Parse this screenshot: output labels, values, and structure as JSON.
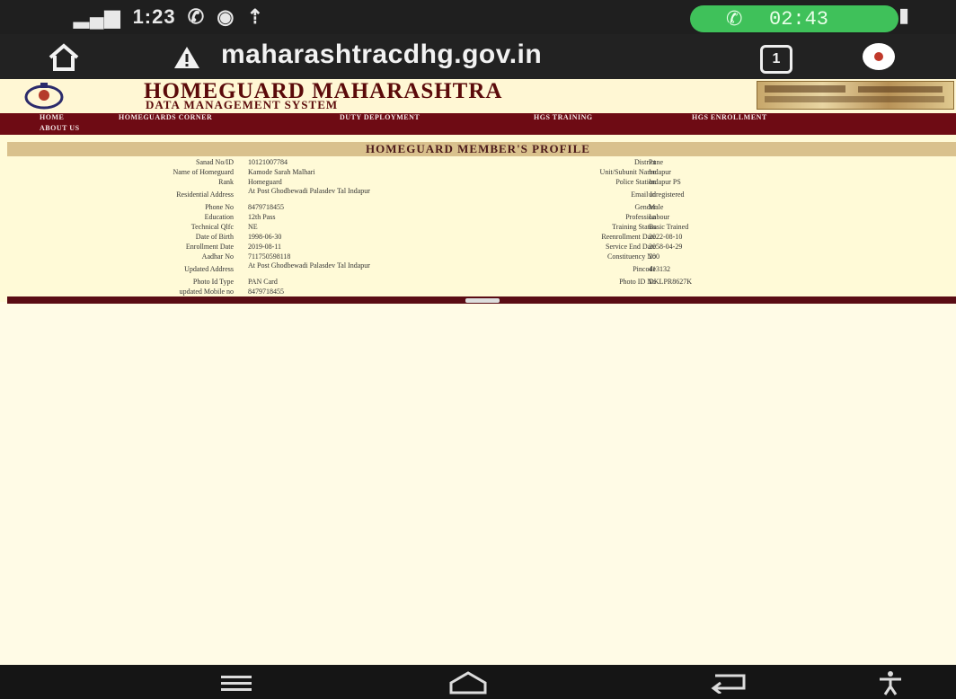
{
  "status_bar": {
    "time": "1:23",
    "call_timer": "02:43"
  },
  "browser": {
    "url": "maharashtracdhg.gov.in",
    "tab_count": "1"
  },
  "site": {
    "title": "HOMEGUARD MAHARASHTRA",
    "subtitle": "DATA MANAGEMENT SYSTEM",
    "nav": [
      "HOME",
      "HOMEGUARDS CORNER",
      "DUTY DEPLOYMENT",
      "HGS TRAINING",
      "HGS ENROLLMENT",
      "ABOUT US"
    ]
  },
  "profile": {
    "title": "HOMEGUARD MEMBER'S PROFILE",
    "left": [
      {
        "label": "Sanad No/ID",
        "value": "10121007784"
      },
      {
        "label": "Name of Homeguard",
        "value": "Kamode Sarah Malhari"
      },
      {
        "label": "Rank",
        "value": "Homeguard"
      },
      {
        "label": "Residential Address",
        "value": "At Post Ghodbewadi Palasdev Tal Indapur"
      },
      {
        "label": "Phone No",
        "value": "8479718455"
      },
      {
        "label": "Education",
        "value": "12th Pass"
      },
      {
        "label": "Technical Qlfc",
        "value": "NE"
      },
      {
        "label": "Date of Birth",
        "value": "1998-06-30"
      },
      {
        "label": "Enrollment Date",
        "value": "2019-08-11"
      },
      {
        "label": "Aadhar No",
        "value": "711750598118"
      },
      {
        "label": "Updated Address",
        "value": "At Post Ghodbewadi Palasdev Tal Indapur"
      },
      {
        "label": "Photo Id Type",
        "value": "PAN Card"
      },
      {
        "label": "updated Mobile no",
        "value": "8479718455"
      }
    ],
    "right": [
      {
        "label": "District",
        "value": "Pune"
      },
      {
        "label": "Unit/Subunit Name",
        "value": "Indapur"
      },
      {
        "label": "Police Station",
        "value": "Indapur PS"
      },
      {
        "label": "Email Id",
        "value": "unregistered"
      },
      {
        "label": "Gender",
        "value": "Male"
      },
      {
        "label": "Profession",
        "value": "Labour"
      },
      {
        "label": "Training Status",
        "value": "Basic Trained"
      },
      {
        "label": "Reenrollment Date",
        "value": "2022-08-10"
      },
      {
        "label": "Service End Date",
        "value": "2058-04-29"
      },
      {
        "label": "Constituency No",
        "value": "200"
      },
      {
        "label": "Pincode",
        "value": "413132"
      },
      {
        "label": "Photo ID No",
        "value": "DKLPR8627K"
      }
    ]
  }
}
